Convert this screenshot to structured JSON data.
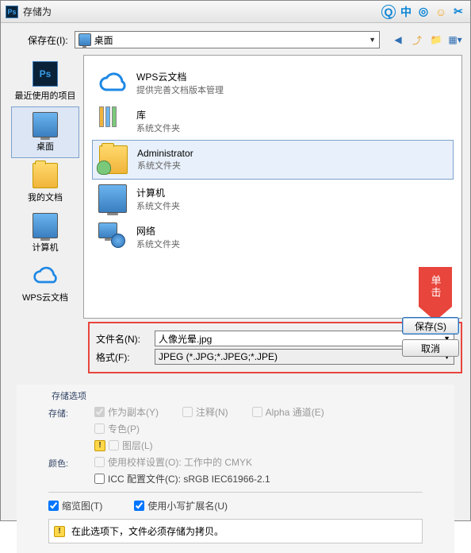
{
  "title": "存储为",
  "savein_label": "保存在(I):",
  "savein_value": "桌面",
  "sidebar": {
    "recent": "最近使用的项目",
    "desktop": "桌面",
    "mydocs": "我的文档",
    "computer": "计算机",
    "wps": "WPS云文档"
  },
  "files": {
    "wps_name": "WPS云文档",
    "wps_sub": "提供完善文档版本管理",
    "lib_name": "库",
    "lib_sub": "系统文件夹",
    "admin_name": "Administrator",
    "admin_sub": "系统文件夹",
    "comp_name": "计算机",
    "comp_sub": "系统文件夹",
    "net_name": "网络",
    "net_sub": "系统文件夹"
  },
  "filename_label": "文件名(N):",
  "filename_value": "人像光晕.jpg",
  "format_label": "格式(F):",
  "format_value": "JPEG (*.JPG;*.JPEG;*.JPE)",
  "save_btn": "保存(S)",
  "cancel_btn": "取消",
  "arrow_text": "单击",
  "options": {
    "group": "存储选项",
    "store": "存储:",
    "copy": "作为副本(Y)",
    "notes": "注释(N)",
    "alpha": "Alpha 通道(E)",
    "spot": "专色(P)",
    "layers": "图层(L)",
    "color": "颜色:",
    "proof": "使用校样设置(O): 工作中的 CMYK",
    "icc": "ICC 配置文件(C): sRGB IEC61966-2.1",
    "thumb": "缩览图(T)",
    "lowerext": "使用小写扩展名(U)",
    "info": "在此选项下，文件必须存储为拷贝。"
  }
}
